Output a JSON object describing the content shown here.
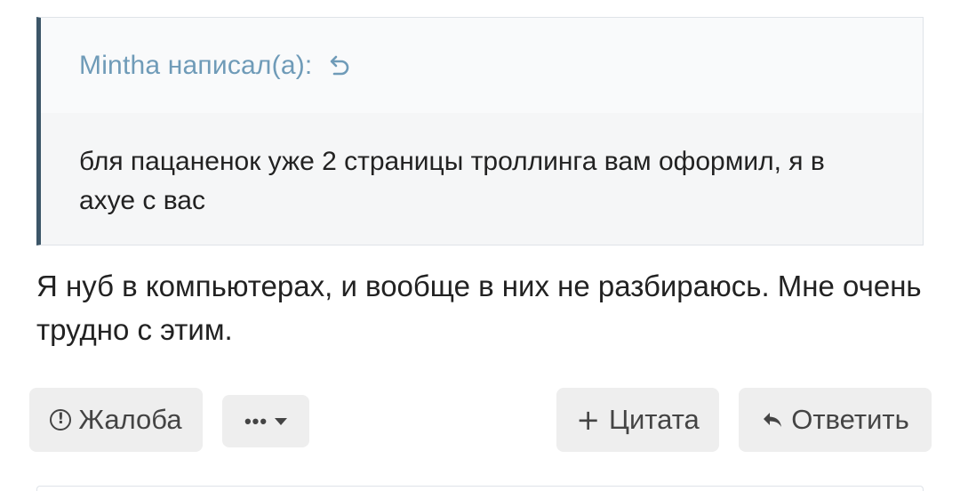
{
  "quote": {
    "author_line": "Mintha написал(а):",
    "text": "бля пацаненок уже 2 страницы троллинга вам оформил, я в ахуе с вас"
  },
  "message": {
    "text": "Я нуб в компьютерах, и вообще в них не разбираюсь. Мне очень трудно с этим."
  },
  "actions": {
    "report_label": "Жалоба",
    "more_label": "•••",
    "quote_label": "Цитата",
    "reply_label": "Ответить"
  },
  "icons": {
    "report": "exclamation-circle-icon",
    "jump": "jump-to-quote-icon",
    "quote": "plus-icon",
    "reply": "reply-arrow-icon",
    "more_caret": "caret-down-icon"
  },
  "colors": {
    "quote_border": "#3c5668",
    "quote_author": "#6f9bb8",
    "button_bg": "#eeeeee"
  }
}
